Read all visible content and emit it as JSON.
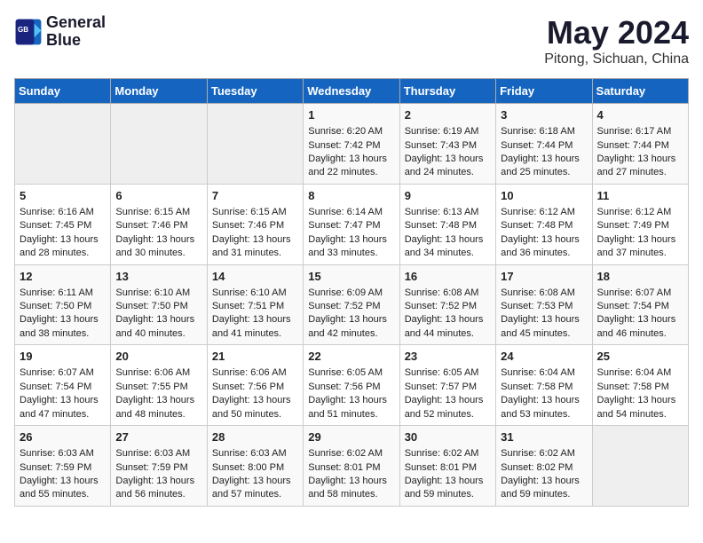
{
  "header": {
    "logo_line1": "General",
    "logo_line2": "Blue",
    "title": "May 2024",
    "subtitle": "Pitong, Sichuan, China"
  },
  "weekdays": [
    "Sunday",
    "Monday",
    "Tuesday",
    "Wednesday",
    "Thursday",
    "Friday",
    "Saturday"
  ],
  "weeks": [
    [
      {
        "day": "",
        "empty": true
      },
      {
        "day": "",
        "empty": true
      },
      {
        "day": "",
        "empty": true
      },
      {
        "day": "1",
        "sunrise": "6:20 AM",
        "sunset": "7:42 PM",
        "daylight": "13 hours and 22 minutes."
      },
      {
        "day": "2",
        "sunrise": "6:19 AM",
        "sunset": "7:43 PM",
        "daylight": "13 hours and 24 minutes."
      },
      {
        "day": "3",
        "sunrise": "6:18 AM",
        "sunset": "7:44 PM",
        "daylight": "13 hours and 25 minutes."
      },
      {
        "day": "4",
        "sunrise": "6:17 AM",
        "sunset": "7:44 PM",
        "daylight": "13 hours and 27 minutes."
      }
    ],
    [
      {
        "day": "5",
        "sunrise": "6:16 AM",
        "sunset": "7:45 PM",
        "daylight": "13 hours and 28 minutes."
      },
      {
        "day": "6",
        "sunrise": "6:15 AM",
        "sunset": "7:46 PM",
        "daylight": "13 hours and 30 minutes."
      },
      {
        "day": "7",
        "sunrise": "6:15 AM",
        "sunset": "7:46 PM",
        "daylight": "13 hours and 31 minutes."
      },
      {
        "day": "8",
        "sunrise": "6:14 AM",
        "sunset": "7:47 PM",
        "daylight": "13 hours and 33 minutes."
      },
      {
        "day": "9",
        "sunrise": "6:13 AM",
        "sunset": "7:48 PM",
        "daylight": "13 hours and 34 minutes."
      },
      {
        "day": "10",
        "sunrise": "6:12 AM",
        "sunset": "7:48 PM",
        "daylight": "13 hours and 36 minutes."
      },
      {
        "day": "11",
        "sunrise": "6:12 AM",
        "sunset": "7:49 PM",
        "daylight": "13 hours and 37 minutes."
      }
    ],
    [
      {
        "day": "12",
        "sunrise": "6:11 AM",
        "sunset": "7:50 PM",
        "daylight": "13 hours and 38 minutes."
      },
      {
        "day": "13",
        "sunrise": "6:10 AM",
        "sunset": "7:50 PM",
        "daylight": "13 hours and 40 minutes."
      },
      {
        "day": "14",
        "sunrise": "6:10 AM",
        "sunset": "7:51 PM",
        "daylight": "13 hours and 41 minutes."
      },
      {
        "day": "15",
        "sunrise": "6:09 AM",
        "sunset": "7:52 PM",
        "daylight": "13 hours and 42 minutes."
      },
      {
        "day": "16",
        "sunrise": "6:08 AM",
        "sunset": "7:52 PM",
        "daylight": "13 hours and 44 minutes."
      },
      {
        "day": "17",
        "sunrise": "6:08 AM",
        "sunset": "7:53 PM",
        "daylight": "13 hours and 45 minutes."
      },
      {
        "day": "18",
        "sunrise": "6:07 AM",
        "sunset": "7:54 PM",
        "daylight": "13 hours and 46 minutes."
      }
    ],
    [
      {
        "day": "19",
        "sunrise": "6:07 AM",
        "sunset": "7:54 PM",
        "daylight": "13 hours and 47 minutes."
      },
      {
        "day": "20",
        "sunrise": "6:06 AM",
        "sunset": "7:55 PM",
        "daylight": "13 hours and 48 minutes."
      },
      {
        "day": "21",
        "sunrise": "6:06 AM",
        "sunset": "7:56 PM",
        "daylight": "13 hours and 50 minutes."
      },
      {
        "day": "22",
        "sunrise": "6:05 AM",
        "sunset": "7:56 PM",
        "daylight": "13 hours and 51 minutes."
      },
      {
        "day": "23",
        "sunrise": "6:05 AM",
        "sunset": "7:57 PM",
        "daylight": "13 hours and 52 minutes."
      },
      {
        "day": "24",
        "sunrise": "6:04 AM",
        "sunset": "7:58 PM",
        "daylight": "13 hours and 53 minutes."
      },
      {
        "day": "25",
        "sunrise": "6:04 AM",
        "sunset": "7:58 PM",
        "daylight": "13 hours and 54 minutes."
      }
    ],
    [
      {
        "day": "26",
        "sunrise": "6:03 AM",
        "sunset": "7:59 PM",
        "daylight": "13 hours and 55 minutes."
      },
      {
        "day": "27",
        "sunrise": "6:03 AM",
        "sunset": "7:59 PM",
        "daylight": "13 hours and 56 minutes."
      },
      {
        "day": "28",
        "sunrise": "6:03 AM",
        "sunset": "8:00 PM",
        "daylight": "13 hours and 57 minutes."
      },
      {
        "day": "29",
        "sunrise": "6:02 AM",
        "sunset": "8:01 PM",
        "daylight": "13 hours and 58 minutes."
      },
      {
        "day": "30",
        "sunrise": "6:02 AM",
        "sunset": "8:01 PM",
        "daylight": "13 hours and 59 minutes."
      },
      {
        "day": "31",
        "sunrise": "6:02 AM",
        "sunset": "8:02 PM",
        "daylight": "13 hours and 59 minutes."
      },
      {
        "day": "",
        "empty": true
      }
    ]
  ]
}
